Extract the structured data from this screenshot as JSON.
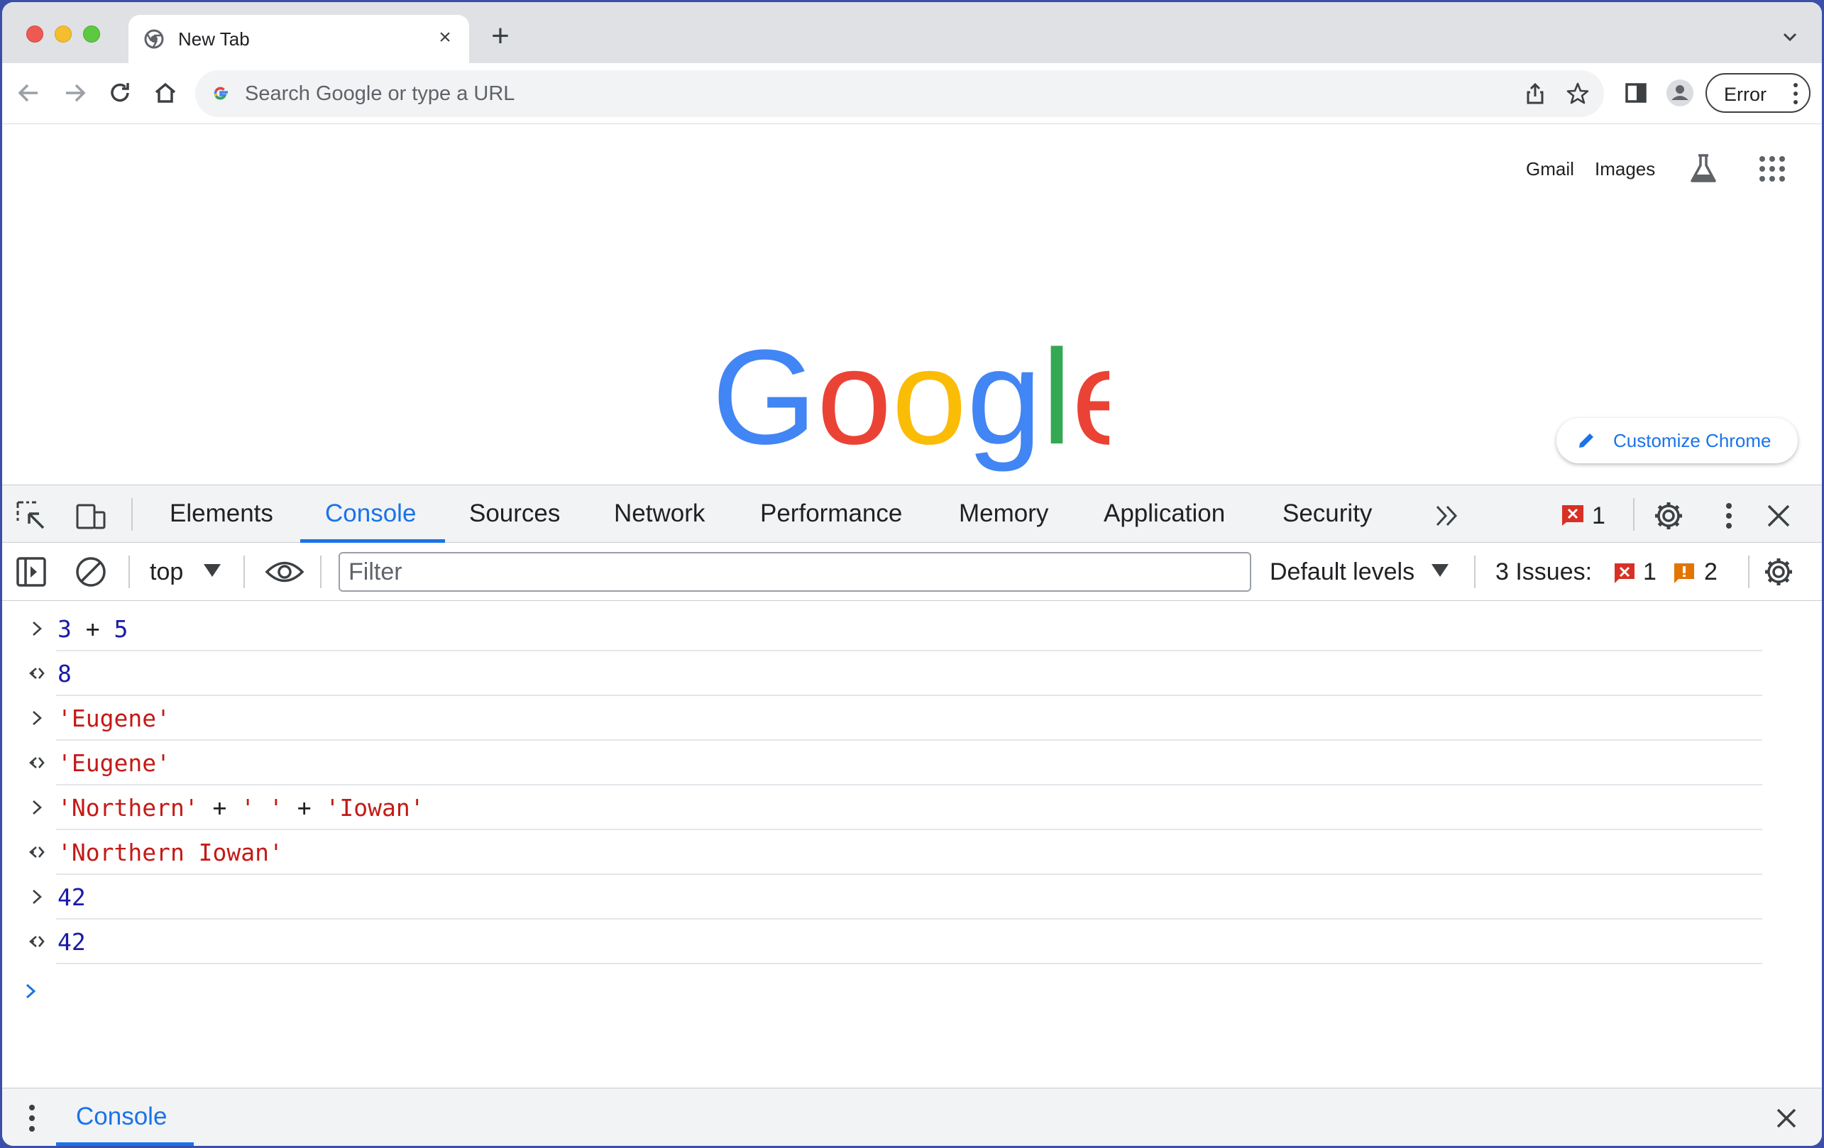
{
  "browser": {
    "tab": {
      "title": "New Tab"
    },
    "new_tab_symbol": "+",
    "close_symbol": "×",
    "omnibox": {
      "placeholder": "Search Google or type a URL"
    },
    "profile_status": "Error"
  },
  "page": {
    "links": {
      "gmail": "Gmail",
      "images": "Images"
    },
    "logo_text": "Google",
    "logo_colors": [
      "#4285f4",
      "#ea4335",
      "#fbbc05",
      "#4285f4",
      "#34a853",
      "#ea4335"
    ],
    "customize_label": "Customize Chrome"
  },
  "devtools": {
    "tabs": [
      {
        "label": "Elements",
        "active": false
      },
      {
        "label": "Console",
        "active": true
      },
      {
        "label": "Sources",
        "active": false
      },
      {
        "label": "Network",
        "active": false
      },
      {
        "label": "Performance",
        "active": false
      },
      {
        "label": "Memory",
        "active": false
      },
      {
        "label": "Application",
        "active": false
      },
      {
        "label": "Security",
        "active": false
      }
    ],
    "error_badge_count": "1",
    "context": "top",
    "filter_placeholder": "Filter",
    "levels_label": "Default levels",
    "issues": {
      "label": "3 Issues:",
      "errors": "1",
      "warnings": "2"
    },
    "console_entries": [
      {
        "kind": "input",
        "tokens": [
          {
            "t": "3",
            "c": "num"
          },
          {
            "t": " + ",
            "c": "op"
          },
          {
            "t": "5",
            "c": "num"
          }
        ]
      },
      {
        "kind": "output",
        "tokens": [
          {
            "t": "8",
            "c": "num"
          }
        ]
      },
      {
        "kind": "input",
        "tokens": [
          {
            "t": "'Eugene'",
            "c": "str"
          }
        ]
      },
      {
        "kind": "output",
        "tokens": [
          {
            "t": "'Eugene'",
            "c": "str"
          }
        ]
      },
      {
        "kind": "input",
        "tokens": [
          {
            "t": "'Northern'",
            "c": "str"
          },
          {
            "t": " + ",
            "c": "op"
          },
          {
            "t": "' '",
            "c": "str"
          },
          {
            "t": " + ",
            "c": "op"
          },
          {
            "t": "'Iowan'",
            "c": "str"
          }
        ]
      },
      {
        "kind": "output",
        "tokens": [
          {
            "t": "'Northern Iowan'",
            "c": "str"
          }
        ]
      },
      {
        "kind": "input",
        "tokens": [
          {
            "t": "42",
            "c": "num"
          }
        ]
      },
      {
        "kind": "output",
        "tokens": [
          {
            "t": "42",
            "c": "num"
          }
        ]
      }
    ],
    "drawer_tab": "Console"
  },
  "colors": {
    "accent": "#1a73e8",
    "number_token": "#1a1aa6",
    "string_token": "#c41a16",
    "error_red": "#d93025",
    "warning_orange": "#e37400"
  }
}
